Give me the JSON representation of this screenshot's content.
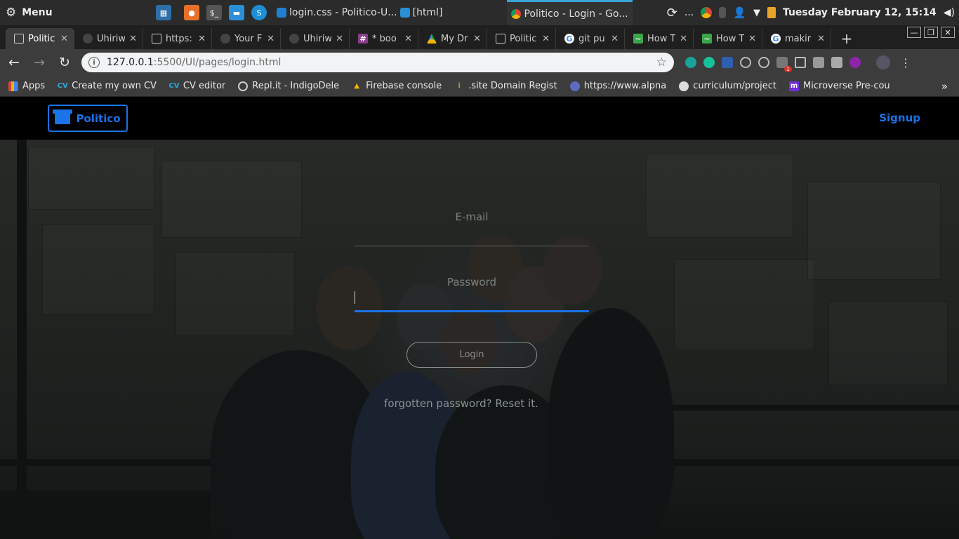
{
  "os": {
    "menu_label": "Menu",
    "windows": [
      {
        "label": "login.css - Politico-U...",
        "active": false
      },
      {
        "label": "[html]",
        "active": false
      },
      {
        "label": "Politico - Login - Go...",
        "active": true
      }
    ],
    "clock": "Tuesday February 12, 15:14",
    "tray_dots": "..."
  },
  "tabs": [
    {
      "label": "Politic",
      "active": true
    },
    {
      "label": "Uhiriw",
      "active": false
    },
    {
      "label": "https:",
      "active": false
    },
    {
      "label": "Your F",
      "active": false
    },
    {
      "label": "Uhiriw",
      "active": false
    },
    {
      "label": "* boo",
      "active": false
    },
    {
      "label": "My Dr",
      "active": false
    },
    {
      "label": "Politic",
      "active": false
    },
    {
      "label": "git pu",
      "active": false
    },
    {
      "label": "How T",
      "active": false
    },
    {
      "label": "How T",
      "active": false
    },
    {
      "label": "makir",
      "active": false
    }
  ],
  "address": {
    "host": "127.0.0.1",
    "path": ":5500/UI/pages/login.html"
  },
  "extension_badge": "1",
  "bookmarks": [
    {
      "label": "Apps"
    },
    {
      "label": "Create my own CV"
    },
    {
      "label": "CV editor"
    },
    {
      "label": "Repl.it - IndigoDele"
    },
    {
      "label": "Firebase console"
    },
    {
      "label": ".site Domain Regist"
    },
    {
      "label": "https://www.alpna"
    },
    {
      "label": "curriculum/project"
    },
    {
      "label": "Microverse Pre-cou"
    }
  ],
  "site": {
    "brand": "Politico",
    "signup": "Signup",
    "email_label": "E-mail",
    "password_label": "Password",
    "login_label": "Login",
    "forgot_text": "forgotten password? Reset it.",
    "accent": "#1a73e8"
  }
}
